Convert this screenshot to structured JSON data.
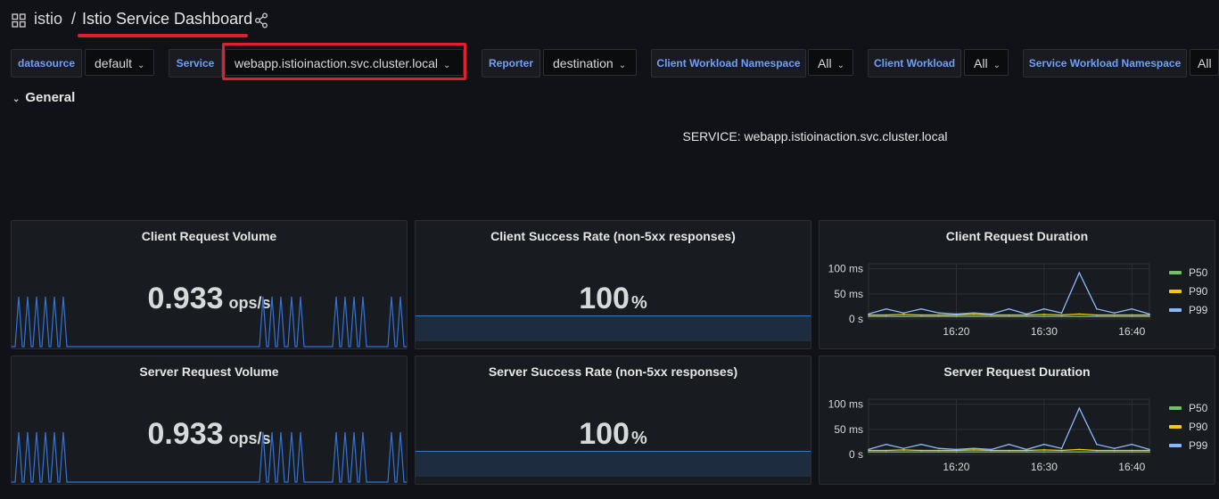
{
  "header": {
    "folder": "istio",
    "separator": "/",
    "title": "Istio Service Dashboard"
  },
  "variables": [
    {
      "label": "datasource",
      "value": "default"
    },
    {
      "label": "Service",
      "value": "webapp.istioinaction.svc.cluster.local"
    },
    {
      "label": "Reporter",
      "value": "destination"
    },
    {
      "label": "Client Workload Namespace",
      "value": "All"
    },
    {
      "label": "Client Workload",
      "value": "All"
    },
    {
      "label": "Service Workload Namespace",
      "value": "All"
    }
  ],
  "row": {
    "title": "General"
  },
  "service_text": "SERVICE: webapp.istioinaction.svc.cluster.local",
  "panels": {
    "client_volume": {
      "title": "Client Request Volume",
      "value": "0.933",
      "unit": "ops/s"
    },
    "client_success": {
      "title": "Client Success Rate (non-5xx responses)",
      "value": "100",
      "unit": "%"
    },
    "client_duration": {
      "title": "Client Request Duration"
    },
    "server_volume": {
      "title": "Server Request Volume",
      "value": "0.933",
      "unit": "ops/s"
    },
    "server_success": {
      "title": "Server Success Rate (non-5xx responses)",
      "value": "100",
      "unit": "%"
    },
    "server_duration": {
      "title": "Server Request Duration"
    }
  },
  "duration_axis": {
    "y_ticks": [
      "100 ms",
      "50 ms",
      "0 s"
    ],
    "x_ticks": [
      "16:20",
      "16:30",
      "16:40"
    ]
  },
  "legend": [
    {
      "name": "P50",
      "color": "#73bf69"
    },
    {
      "name": "P90",
      "color": "#f2cc0c"
    },
    {
      "name": "P99",
      "color": "#8ab8ff"
    }
  ],
  "colors": {
    "accent": "#6e9fff",
    "highlight": "#e0202c",
    "spark": "#3274d9"
  },
  "chart_data": [
    {
      "type": "line",
      "title": "Client Request Duration",
      "ylabel": "",
      "xlabel": "",
      "ylim": [
        0,
        110
      ],
      "x": [
        "16:10",
        "16:12",
        "16:14",
        "16:16",
        "16:18",
        "16:20",
        "16:22",
        "16:24",
        "16:26",
        "16:28",
        "16:30",
        "16:32",
        "16:34",
        "16:36",
        "16:38",
        "16:40",
        "16:42"
      ],
      "series": [
        {
          "name": "P50",
          "values": [
            5,
            5,
            5,
            5,
            5,
            5,
            5,
            5,
            5,
            5,
            5,
            5,
            5,
            5,
            5,
            5,
            5
          ]
        },
        {
          "name": "P90",
          "values": [
            8,
            8,
            9,
            8,
            8,
            8,
            9,
            8,
            8,
            8,
            9,
            8,
            10,
            8,
            8,
            8,
            8
          ]
        },
        {
          "name": "P99",
          "values": [
            10,
            20,
            12,
            20,
            12,
            10,
            12,
            10,
            20,
            10,
            20,
            12,
            92,
            20,
            12,
            20,
            10
          ]
        }
      ],
      "legend": "right",
      "grid": true
    },
    {
      "type": "line",
      "title": "Server Request Duration",
      "ylabel": "",
      "xlabel": "",
      "ylim": [
        0,
        110
      ],
      "x": [
        "16:10",
        "16:12",
        "16:14",
        "16:16",
        "16:18",
        "16:20",
        "16:22",
        "16:24",
        "16:26",
        "16:28",
        "16:30",
        "16:32",
        "16:34",
        "16:36",
        "16:38",
        "16:40",
        "16:42"
      ],
      "series": [
        {
          "name": "P50",
          "values": [
            5,
            5,
            5,
            5,
            5,
            5,
            5,
            5,
            5,
            5,
            5,
            5,
            5,
            5,
            5,
            5,
            5
          ]
        },
        {
          "name": "P90",
          "values": [
            8,
            8,
            9,
            8,
            8,
            8,
            9,
            8,
            8,
            8,
            9,
            8,
            10,
            8,
            8,
            8,
            8
          ]
        },
        {
          "name": "P99",
          "values": [
            10,
            20,
            12,
            20,
            12,
            10,
            12,
            10,
            20,
            10,
            20,
            12,
            92,
            20,
            12,
            20,
            10
          ]
        }
      ],
      "legend": "right",
      "grid": true
    }
  ]
}
